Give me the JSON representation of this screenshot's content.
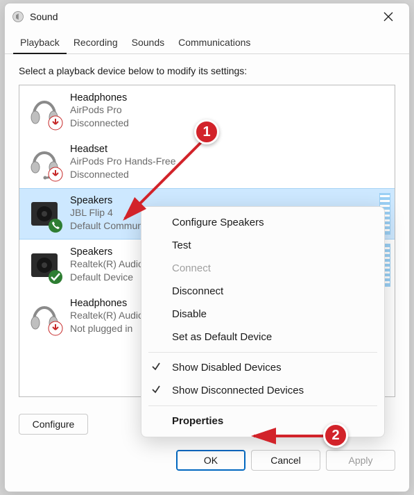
{
  "window": {
    "title": "Sound"
  },
  "tabs": [
    "Playback",
    "Recording",
    "Sounds",
    "Communications"
  ],
  "active_tab_index": 0,
  "prompt": "Select a playback device below to modify its settings:",
  "devices": [
    {
      "name": "Headphones",
      "line2": "AirPods Pro",
      "line3": "Disconnected",
      "icon": "headphones",
      "overlay": "down-red",
      "selected": false,
      "vu": false
    },
    {
      "name": "Headset",
      "line2": "AirPods Pro Hands-Free",
      "line3": "Disconnected",
      "icon": "headset",
      "overlay": "down-red",
      "selected": false,
      "vu": false
    },
    {
      "name": "Speakers",
      "line2": "JBL Flip 4",
      "line3": "Default Communication",
      "icon": "speaker-dark",
      "overlay": "phone-green",
      "selected": true,
      "vu": true
    },
    {
      "name": "Speakers",
      "line2": "Realtek(R) Audio",
      "line3": "Default Device",
      "icon": "speaker-dark",
      "overlay": "check-green",
      "selected": false,
      "vu": true
    },
    {
      "name": "Headphones",
      "line2": "Realtek(R) Audio",
      "line3": "Not plugged in",
      "icon": "headphones",
      "overlay": "down-red",
      "selected": false,
      "vu": false
    }
  ],
  "context_menu": {
    "items": [
      {
        "label": "Configure Speakers",
        "enabled": true
      },
      {
        "label": "Test",
        "enabled": true
      },
      {
        "label": "Connect",
        "enabled": false
      },
      {
        "label": "Disconnect",
        "enabled": true
      },
      {
        "label": "Disable",
        "enabled": true
      },
      {
        "label": "Set as Default Device",
        "enabled": true
      }
    ],
    "checks": [
      {
        "label": "Show Disabled Devices",
        "checked": true
      },
      {
        "label": "Show Disconnected Devices",
        "checked": true
      }
    ],
    "bold_item": {
      "label": "Properties"
    }
  },
  "buttons": {
    "configure": "Configure",
    "ok": "OK",
    "cancel": "Cancel",
    "apply": "Apply"
  },
  "annotations": {
    "step1": "1",
    "step2": "2"
  }
}
